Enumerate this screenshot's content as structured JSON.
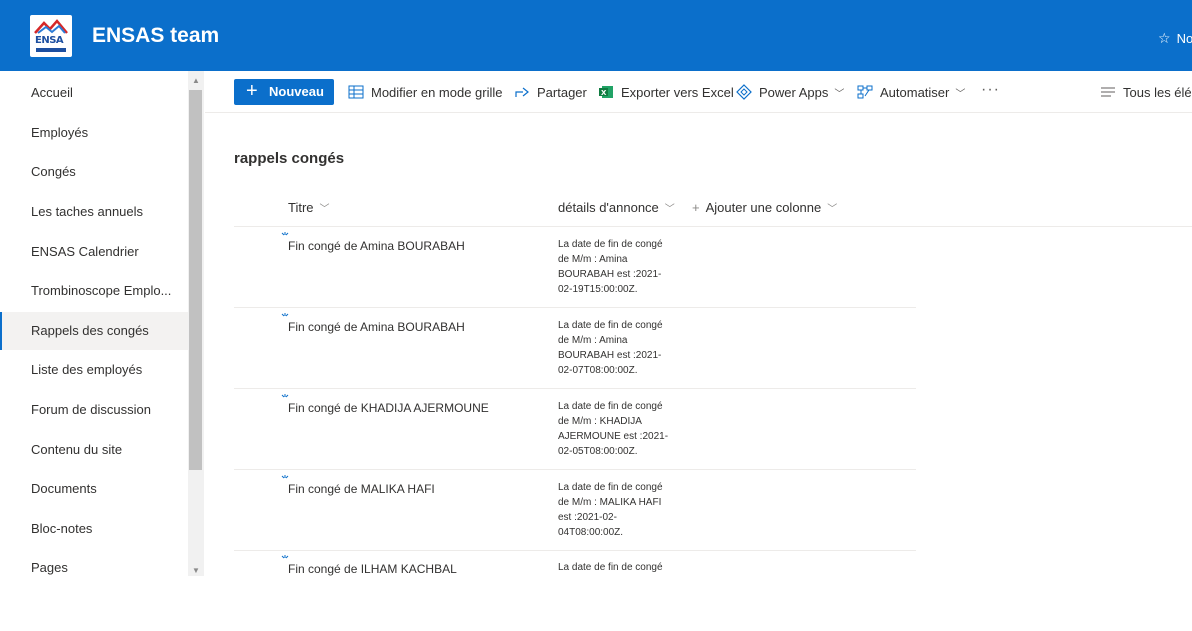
{
  "header": {
    "site_title": "ENSAS team",
    "logo_text": "ENSA",
    "follow_label": "No",
    "accent": "#0b6fcb"
  },
  "sidebar": {
    "items": [
      {
        "label": "Accueil"
      },
      {
        "label": "Employés"
      },
      {
        "label": "Congés"
      },
      {
        "label": "Les taches annuels"
      },
      {
        "label": "ENSAS Calendrier"
      },
      {
        "label": "Trombinoscope Emplo..."
      },
      {
        "label": "Rappels des congés",
        "active": true
      },
      {
        "label": "Liste des employés"
      },
      {
        "label": "Forum de discussion"
      },
      {
        "label": "Contenu du site"
      },
      {
        "label": "Documents"
      },
      {
        "label": "Bloc-notes"
      },
      {
        "label": "Pages"
      }
    ]
  },
  "commandbar": {
    "new_label": "Nouveau",
    "grid_label": "Modifier en mode grille",
    "share_label": "Partager",
    "excel_label": "Exporter vers Excel",
    "powerapps_label": "Power Apps",
    "automate_label": "Automatiser",
    "more_label": "···",
    "view_label": "Tous les élém"
  },
  "list": {
    "title": "rappels congés",
    "columns": {
      "title": "Titre",
      "details": "détails d'annonce",
      "add_column": "Ajouter une colonne"
    },
    "rows": [
      {
        "title": "Fin congé de Amina BOURABAH",
        "details": [
          "La date de fin de congé",
          "de M/m : Amina",
          "BOURABAH est :2021-",
          "02-19T15:00:00Z."
        ]
      },
      {
        "title": "Fin congé de Amina BOURABAH",
        "details": [
          "La date de fin de congé",
          "de M/m : Amina",
          "BOURABAH est :2021-",
          "02-07T08:00:00Z."
        ]
      },
      {
        "title": "Fin congé de KHADIJA AJERMOUNE",
        "details": [
          "La date de fin de congé",
          "de M/m : KHADIJA",
          "AJERMOUNE est :2021-",
          "02-05T08:00:00Z."
        ]
      },
      {
        "title": "Fin congé de MALIKA HAFI",
        "details": [
          "La date de fin de congé",
          "de M/m : MALIKA HAFI",
          "est :2021-02-",
          "04T08:00:00Z."
        ]
      },
      {
        "title": "Fin congé de ILHAM KACHBAL",
        "details": [
          "La date de fin de congé",
          "",
          "",
          ""
        ]
      }
    ]
  }
}
